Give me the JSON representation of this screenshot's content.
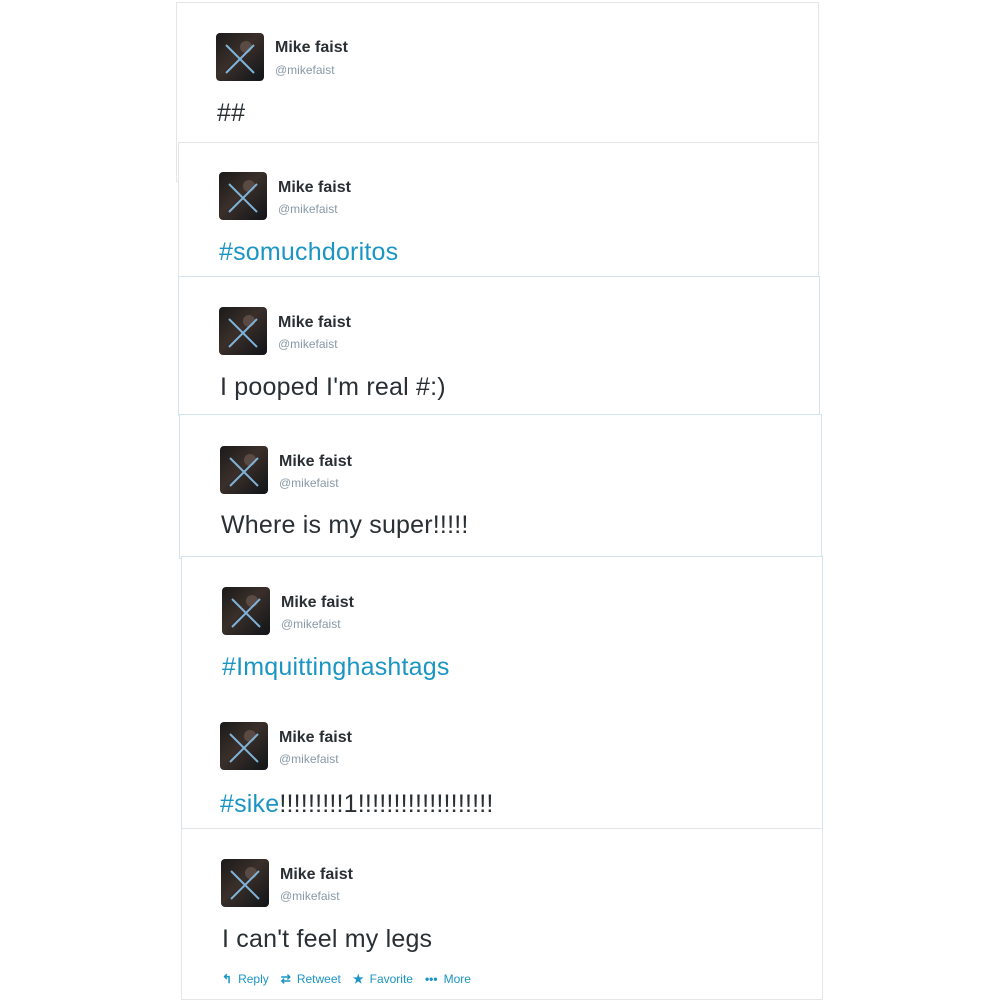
{
  "tweets": [
    {
      "name": "Mike faist",
      "handle": "@mikefaist",
      "text": "##",
      "hashtag": ""
    },
    {
      "name": "Mike faist",
      "handle": "@mikefaist",
      "text": "",
      "hashtag": "#somuchdoritos"
    },
    {
      "name": "Mike faist",
      "handle": "@mikefaist",
      "text": "I pooped I'm real #:)",
      "hashtag": ""
    },
    {
      "name": "Mike faist",
      "handle": "@mikefaist",
      "text": "Where is my super!!!!!",
      "hashtag": ""
    },
    {
      "name": "Mike faist",
      "handle": "@mikefaist",
      "text": "",
      "hashtag": "#Imquittinghashtags"
    },
    {
      "name": "Mike faist",
      "handle": "@mikefaist",
      "text": "!!!!!!!!!1!!!!!!!!!!!!!!!!!!!",
      "hashtag": "#sike"
    },
    {
      "name": "Mike faist",
      "handle": "@mikefaist",
      "text": "I can't feel my legs",
      "hashtag": ""
    }
  ],
  "actions": {
    "reply": {
      "label": "Reply",
      "icon": "reply-icon"
    },
    "retweet": {
      "label": "Retweet",
      "icon": "retweet-icon"
    },
    "favorite": {
      "label": "Favorite",
      "icon": "star-icon"
    },
    "more": {
      "label": "More",
      "icon": "ellipsis-icon"
    }
  },
  "colors": {
    "hashtag": "#1b95c4",
    "name": "#292f33",
    "handle": "#8899a6",
    "border": "#e3e7ea"
  }
}
